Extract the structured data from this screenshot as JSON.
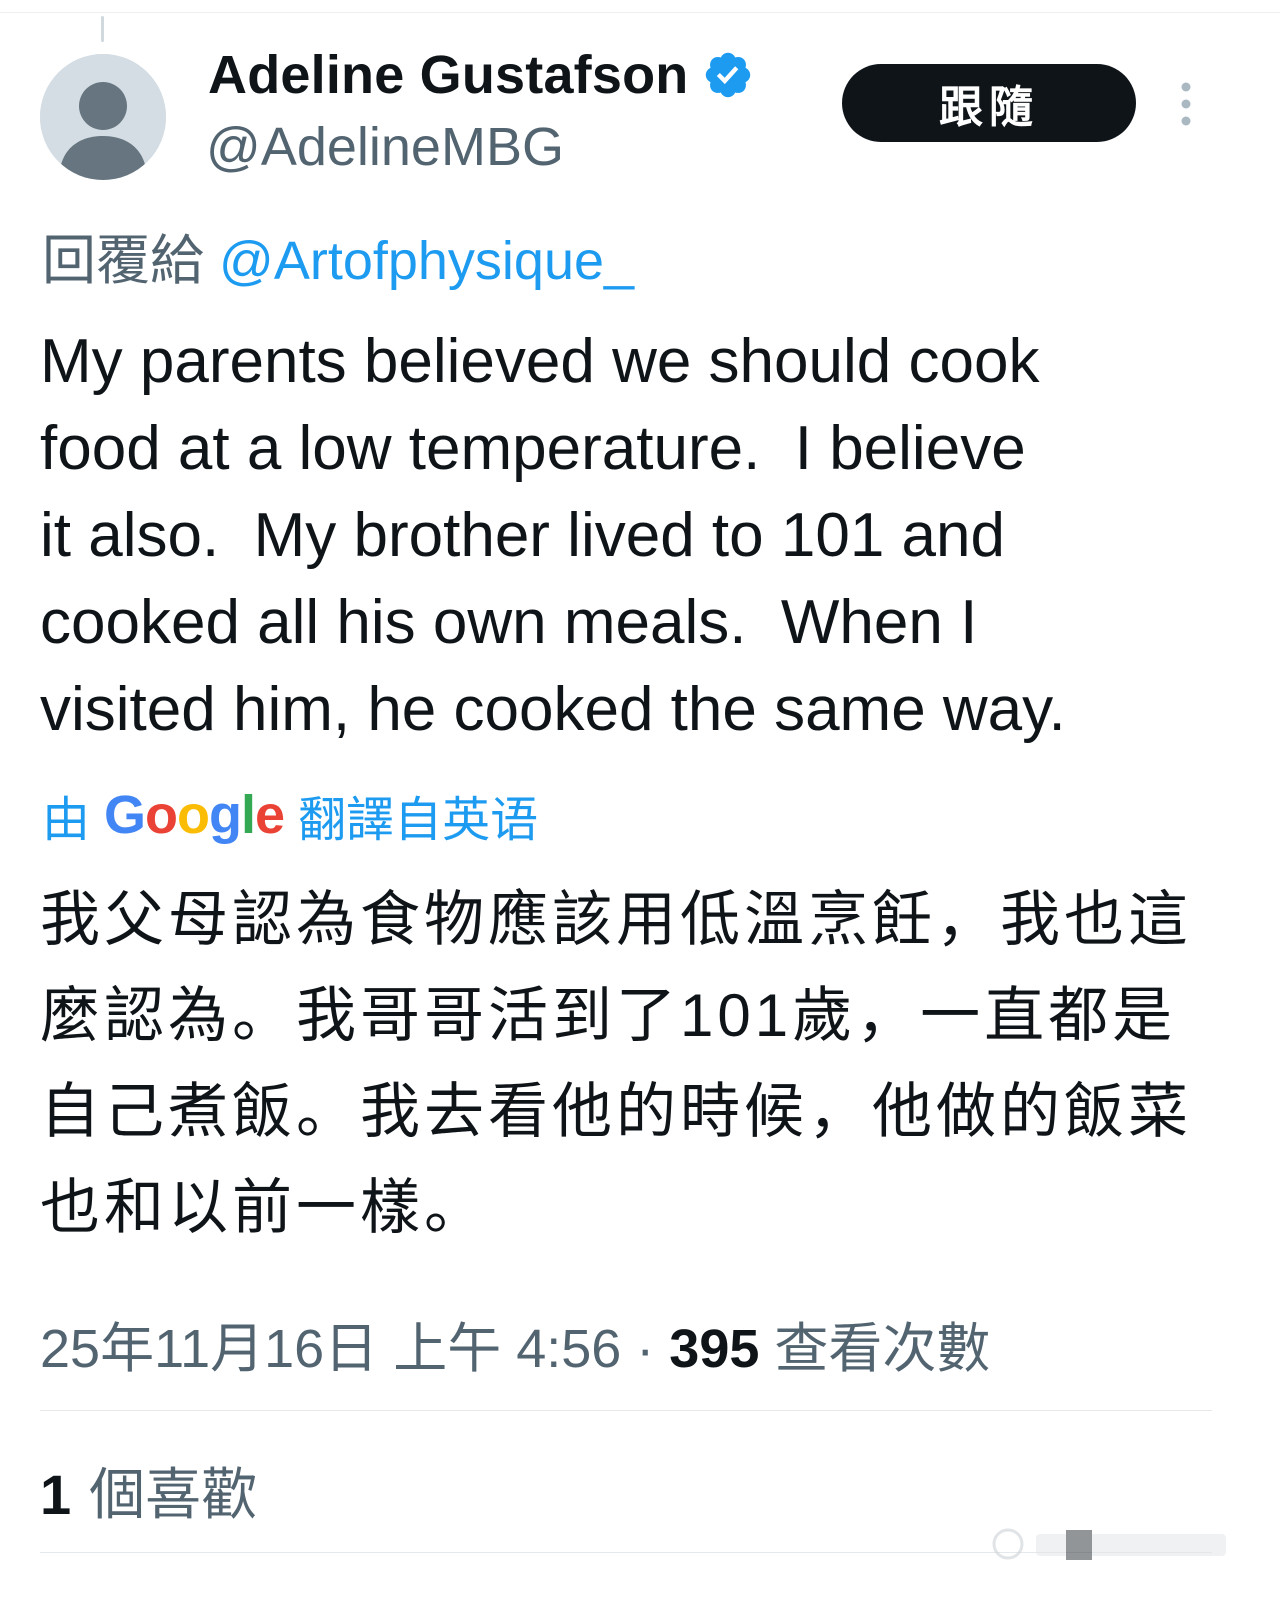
{
  "author": {
    "display_name": "Adeline Gustafson",
    "handle": "@AdelineMBG",
    "verified": true
  },
  "follow_button": {
    "label": "跟隨"
  },
  "reply": {
    "prefix": "回覆給",
    "to_handle": "@Artofphysique_"
  },
  "tweet": {
    "text": "My parents believed we should cook\nfood at a low temperature.  I believe\nit also.  My brother lived to 101 and\ncooked all his own meals.  When I\nvisited him, he cooked the same way."
  },
  "translation": {
    "prefix": "由",
    "google": {
      "G": "G",
      "o1": "o",
      "o2": "o",
      "g": "g",
      "l": "l",
      "e": "e"
    },
    "suffix": "翻譯自英语",
    "text": "我父母認為食物應該用低溫烹飪，我也這麼認為。我哥哥活到了101歲，一直都是自己煮飯。我去看他的時候，他做的飯菜也和以前一樣。"
  },
  "meta": {
    "timestamp": "25年11月16日 上午 4:56 · ",
    "views_count": "395",
    "views_label": "查看次數"
  },
  "likes": {
    "count": "1",
    "label": "個喜歡"
  },
  "colors": {
    "accent": "#1d9bf0",
    "text": "#0f1419",
    "secondary_text": "#536471",
    "button_bg": "#0f1419"
  },
  "icons": {
    "verified": "verified-badge-icon",
    "more": "more-vertical-icon",
    "avatar": "default-avatar-icon"
  }
}
